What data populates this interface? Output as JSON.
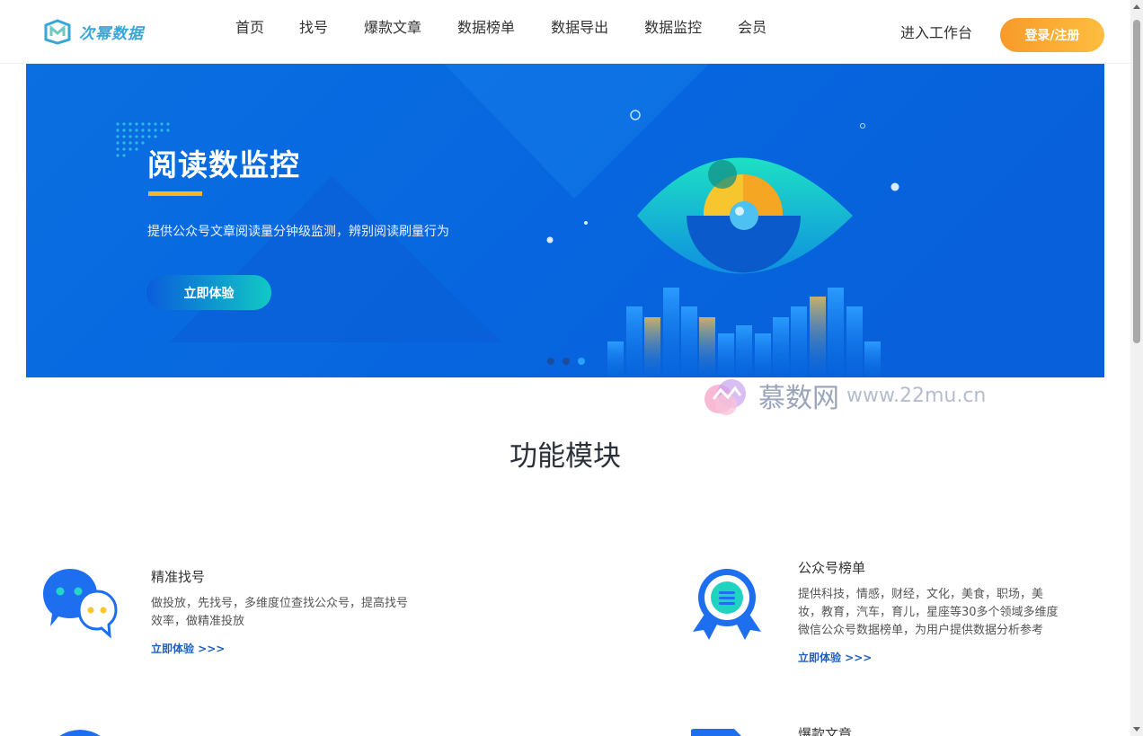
{
  "header": {
    "logo_text": "次幂数据",
    "nav": [
      "首页",
      "找号",
      "爆款文章",
      "数据榜单",
      "数据导出",
      "数据监控",
      "会员"
    ],
    "workbench": "进入工作台",
    "login": "登录/注册"
  },
  "banner": {
    "title": "阅读数监控",
    "description": "提供公众号文章阅读量分钟级监测，辨别阅读刷量行为",
    "cta": "立即体验",
    "slide_count": 3,
    "active_slide": 3
  },
  "watermark": {
    "cn": "慕数网",
    "url": "www.22mu.cn"
  },
  "section": {
    "title": "功能模块"
  },
  "features": [
    {
      "title": "精准找号",
      "desc_line1": "做投放，先找号，多维度位查找公众号，提高找号",
      "desc_line2": "效率，做精准投放",
      "link": "立即体验 >>>"
    },
    {
      "title": "公众号榜单",
      "desc_line1": "提供科技，情感，财经，文化，美食，职场，美",
      "desc_line2": "妆，教育，汽车，育儿，星座等30多个领域多维度",
      "desc_line3": "微信公众号数据榜单，为用户提供数据分析参考",
      "link": "立即体验 >>>"
    },
    {
      "title": "爆款文章"
    }
  ],
  "colors": {
    "brand": "#3aa6d8",
    "banner_blue": "#0766df",
    "accent_orange": "#f89a2a",
    "underline_yellow": "#fbb424",
    "link_blue": "#1f5fbf"
  }
}
